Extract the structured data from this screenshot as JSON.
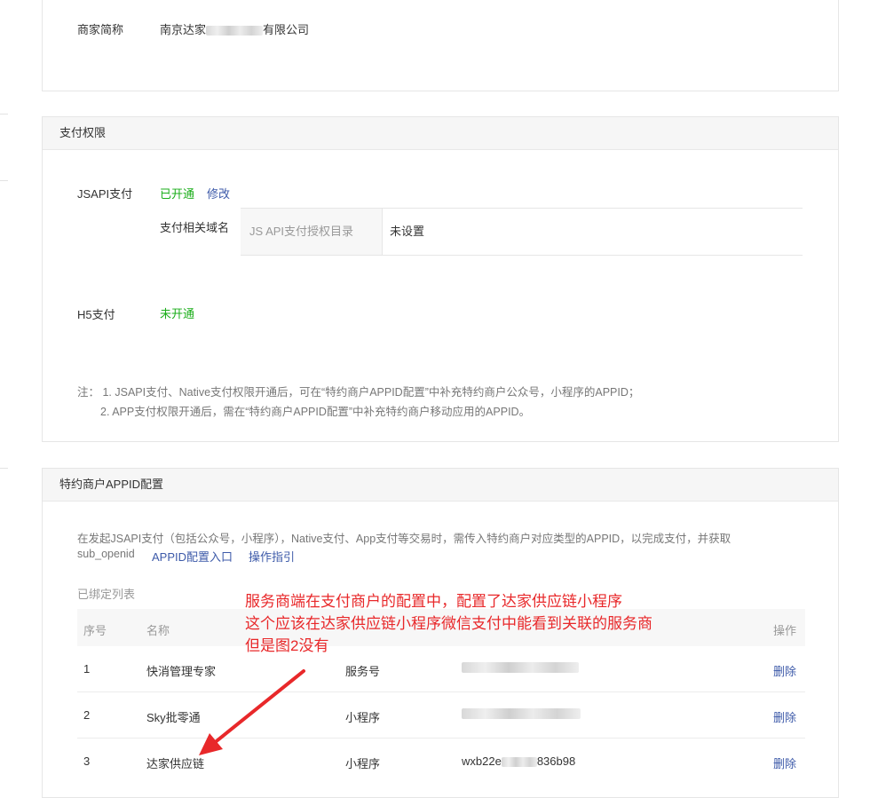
{
  "merchant": {
    "short_name_label": "商家简称",
    "short_name_prefix": "南京达家",
    "short_name_suffix": "有限公司"
  },
  "pay_permission": {
    "title": "支付权限",
    "jsapi": {
      "label": "JSAPI支付",
      "status": "已开通",
      "modify": "修改",
      "domain_label": "支付相关域名",
      "domain_key": "JS API支付授权目录",
      "domain_value": "未设置"
    },
    "h5": {
      "label": "H5支付",
      "status": "未开通"
    },
    "notes": [
      "注：  1. JSAPI支付、Native支付权限开通后，可在“特约商户APPID配置”中补充特约商户公众号，小程序的APPID；",
      "2. APP支付权限开通后，需在“特约商户APPID配置”中补充特约商户移动应用的APPID。"
    ]
  },
  "appid_config": {
    "title": "特约商户APPID配置",
    "desc_line1": "在发起JSAPI支付（包括公众号，小程序），Native支付、App支付等交易时，需传入特约商户对应类型的APPID，以完成支付，并获取",
    "desc_line2_prefix": "sub_openid",
    "entry_link": "APPID配置入口",
    "guide_link": "操作指引",
    "bound_list_label": "已绑定列表",
    "table": {
      "headers": {
        "index": "序号",
        "name": "名称",
        "action": "操作"
      },
      "rows": [
        {
          "index": "1",
          "name": "快消管理专家",
          "type": "服务号",
          "appid": "",
          "action": "删除"
        },
        {
          "index": "2",
          "name": "Sky批零通",
          "type": "小程序",
          "appid": "",
          "action": "删除"
        },
        {
          "index": "3",
          "name": "达家供应链",
          "type": "小程序",
          "appid_prefix": "wxb22e",
          "appid_suffix": "836b98",
          "action": "删除"
        }
      ]
    }
  },
  "annotation": {
    "lines": [
      "服务商端在支付商户的配置中，配置了达家供应链小程序",
      "这个应该在达家供应链小程序微信支付中能看到关联的服务商",
      "但是图2没有"
    ],
    "color": "#e8282a"
  },
  "colors": {
    "green": "#1aad19",
    "link": "#3d5aa9",
    "annotation": "#e8282a"
  }
}
